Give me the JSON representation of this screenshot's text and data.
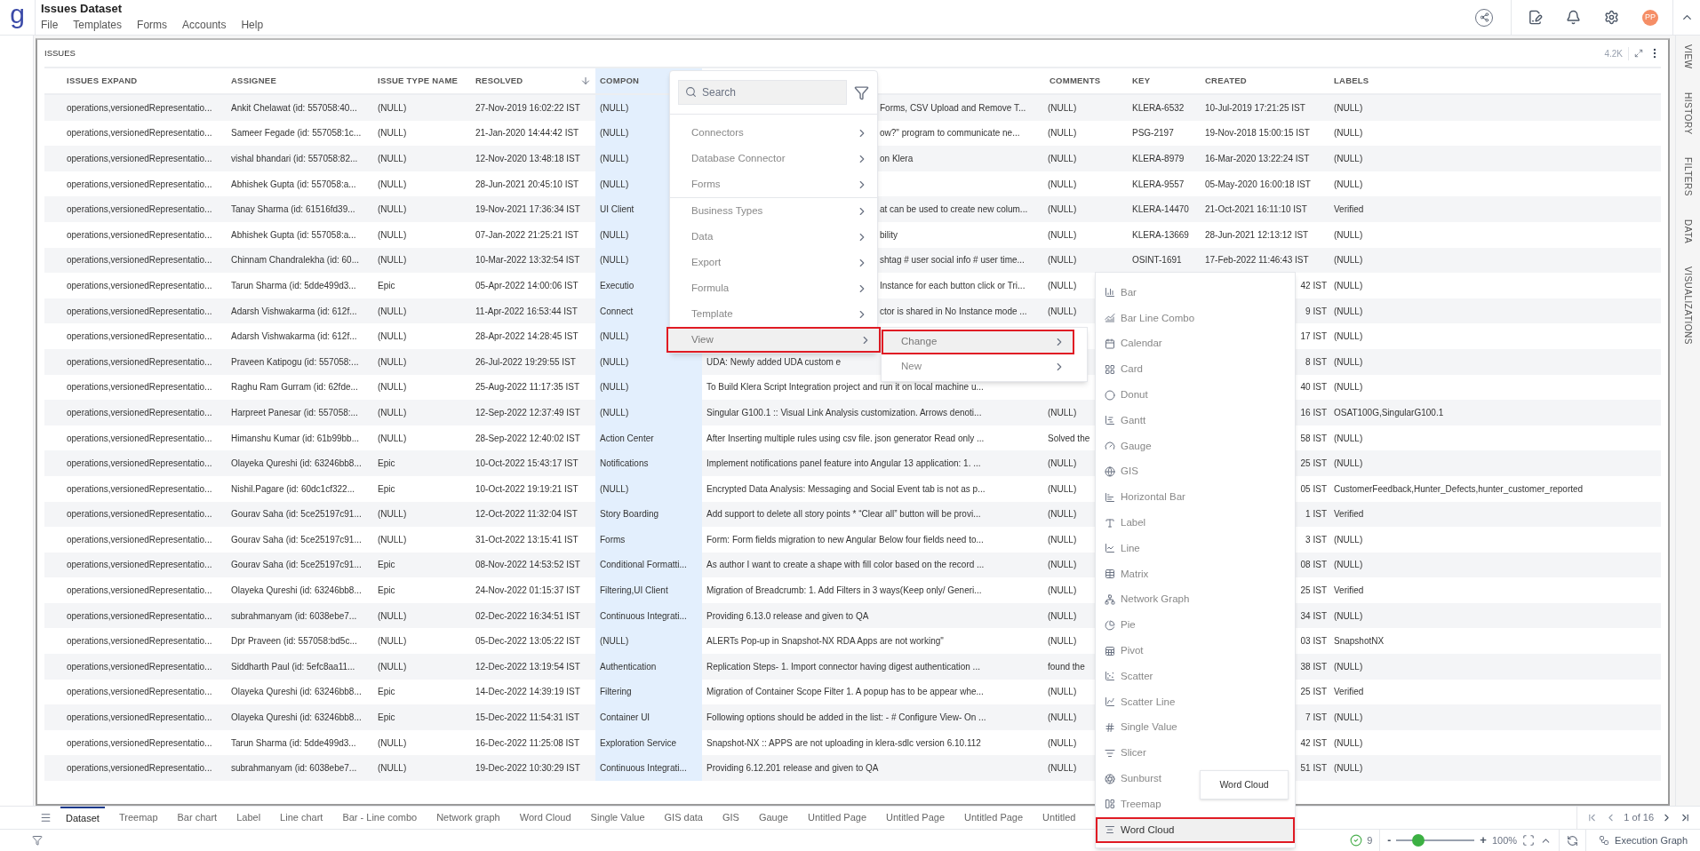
{
  "app": {
    "logo": "g",
    "title": "Issues Dataset",
    "menu": [
      "File",
      "Templates",
      "Forms",
      "Accounts",
      "Help"
    ],
    "avatar": "PP"
  },
  "side_tabs": [
    "VIEW",
    "HISTORY",
    "FILTERS",
    "DATA",
    "VISUALIZATIONS"
  ],
  "panel": {
    "title": "ISSUES",
    "count": "4.2K"
  },
  "table": {
    "columns": [
      {
        "label": "ISSUES EXPAND",
        "sorted": false,
        "highlighted": false
      },
      {
        "label": "ASSIGNEE",
        "sorted": false,
        "highlighted": false
      },
      {
        "label": "ISSUE TYPE NAME",
        "sorted": false,
        "highlighted": false
      },
      {
        "label": "RESOLVED",
        "sorted": true,
        "highlighted": false
      },
      {
        "label": "COMPON",
        "sorted": false,
        "highlighted": true
      },
      null,
      {
        "label": "COMMENTS",
        "sorted": false,
        "highlighted": false
      },
      {
        "label": "KEY",
        "sorted": false,
        "highlighted": false
      },
      {
        "label": "CREATED",
        "sorted": false,
        "highlighted": false
      },
      {
        "label": "LABELS",
        "sorted": false,
        "highlighted": false
      }
    ],
    "rows": [
      [
        "operations,versionedRepresentatio...",
        "Ankit Chelawat (id: 557058:40...",
        "(NULL)",
        "27-Nov-2019 16:02:22 IST",
        "(NULL)",
        "Forms, CSV Upload and Remove T...",
        "(NULL)",
        "KLERA-6532",
        "10-Jul-2019 17:21:25 IST",
        "(NULL)"
      ],
      [
        "operations,versionedRepresentatio...",
        "Sameer Fegade (id: 557058:1c...",
        "(NULL)",
        "21-Jan-2020 14:44:42 IST",
        "(NULL)",
        "ow?\" program to communicate ne...",
        "(NULL)",
        "PSG-2197",
        "19-Nov-2018 15:00:15 IST",
        "(NULL)"
      ],
      [
        "operations,versionedRepresentatio...",
        "vishal bhandari (id: 557058:82...",
        "(NULL)",
        "12-Nov-2020 13:48:18 IST",
        "(NULL)",
        "on Klera",
        "(NULL)",
        "KLERA-8979",
        "16-Mar-2020 13:22:24 IST",
        "(NULL)"
      ],
      [
        "operations,versionedRepresentatio...",
        "Abhishek Gupta (id: 557058:a...",
        "(NULL)",
        "28-Jun-2021 20:45:10 IST",
        "(NULL)",
        null,
        "(NULL)",
        "KLERA-9557",
        "05-May-2020 16:00:18 IST",
        "(NULL)"
      ],
      [
        "operations,versionedRepresentatio...",
        "Tanay Sharma (id: 61516fd39...",
        "(NULL)",
        "19-Nov-2021 17:36:34 IST",
        "UI Client",
        "at can be used to create new colum...",
        "(NULL)",
        "KLERA-14470",
        "21-Oct-2021 16:11:10 IST",
        "Verified"
      ],
      [
        "operations,versionedRepresentatio...",
        "Abhishek Gupta (id: 557058:a...",
        "(NULL)",
        "07-Jan-2022 21:25:21 IST",
        "(NULL)",
        "bility",
        "(NULL)",
        "KLERA-13669",
        "28-Jun-2021 12:13:12 IST",
        "(NULL)"
      ],
      [
        "operations,versionedRepresentatio...",
        "Chinnam Chandralekha (id: 60...",
        "(NULL)",
        "10-Mar-2022 13:32:54 IST",
        "(NULL)",
        "shtag # user social info # user time...",
        "(NULL)",
        "OSINT-1691",
        "17-Feb-2022 11:46:43 IST",
        "(NULL)"
      ],
      [
        "operations,versionedRepresentatio...",
        "Tarun Sharma (id: 5dde499d3...",
        "Epic",
        "05-Apr-2022 14:00:06 IST",
        "Executio",
        "Instance for each button click or Tri...",
        "(NULL)",
        null,
        "42 IST",
        "(NULL)"
      ],
      [
        "operations,versionedRepresentatio...",
        "Adarsh Vishwakarma (id: 612f...",
        "(NULL)",
        "11-Apr-2022 16:53:44 IST",
        "Connect",
        "ctor is shared in No Instance mode ...",
        "(NULL)",
        null,
        "9 IST",
        "(NULL)"
      ],
      [
        "operations,versionedRepresentatio...",
        "Adarsh Vishwakarma (id: 612f...",
        "(NULL)",
        "28-Apr-2022 14:28:45 IST",
        "(NULL)",
        null,
        null,
        null,
        "17 IST",
        "(NULL)"
      ],
      [
        "operations,versionedRepresentatio...",
        "Praveen Katipogu (id: 557058:...",
        "(NULL)",
        "26-Jul-2022 19:29:55 IST",
        "(NULL)",
        "UDA: Newly added UDA custom e",
        null,
        null,
        "8 IST",
        "(NULL)"
      ],
      [
        "operations,versionedRepresentatio...",
        "Raghu Ram Gurram (id: 62fde...",
        "(NULL)",
        "25-Aug-2022 11:17:35 IST",
        "(NULL)",
        "To Build Klera Script Integration project and run it on local machine u...",
        null,
        null,
        "40 IST",
        "(NULL)"
      ],
      [
        "operations,versionedRepresentatio...",
        "Harpreet Panesar (id: 557058:...",
        "(NULL)",
        "12-Sep-2022 12:37:49 IST",
        "(NULL)",
        "Singular G100.1 :: Visual Link Analysis customization. Arrows denoti...",
        "(NULL)",
        null,
        "16 IST",
        "OSAT100G,SingularG100.1"
      ],
      [
        "operations,versionedRepresentatio...",
        "Himanshu Kumar (id: 61b99bb...",
        "(NULL)",
        "28-Sep-2022 12:40:02 IST",
        "Action Center",
        "After Inserting multiple rules using csv file. json generator Read only ...",
        "Solved the",
        null,
        "58 IST",
        "(NULL)"
      ],
      [
        "operations,versionedRepresentatio...",
        "Olayeka Qureshi (id: 63246bb8...",
        "Epic",
        "10-Oct-2022 15:43:17 IST",
        "Notifications",
        "Implement notifications panel feature into Angular 13 application: 1. ...",
        "(NULL)",
        null,
        "25 IST",
        "(NULL)"
      ],
      [
        "operations,versionedRepresentatio...",
        "Nishil.Pagare (id: 60dc1cf322...",
        "Epic",
        "10-Oct-2022 19:19:21 IST",
        "(NULL)",
        "Encrypted Data Analysis: Messaging and Social Event tab is not as p...",
        "(NULL)",
        null,
        "05 IST",
        "CustomerFeedback,Hunter_Defects,hunter_customer_reported"
      ],
      [
        "operations,versionedRepresentatio...",
        "Gourav Saha (id: 5ce25197c91...",
        "(NULL)",
        "12-Oct-2022 11:32:04 IST",
        "Story Boarding",
        "Add support to delete all story points * “Clear all” button will be provi...",
        "(NULL)",
        null,
        "1 IST",
        "Verified"
      ],
      [
        "operations,versionedRepresentatio...",
        "Gourav Saha (id: 5ce25197c91...",
        "(NULL)",
        "31-Oct-2022 13:15:41 IST",
        "Forms",
        "Form: Form fields migration to new Angular Below four fields need to...",
        "(NULL)",
        null,
        "3 IST",
        "(NULL)"
      ],
      [
        "operations,versionedRepresentatio...",
        "Gourav Saha (id: 5ce25197c91...",
        "Epic",
        "08-Nov-2022 14:53:52 IST",
        "Conditional Formatti...",
        "As author I want to create a shape with fill color based on the record ...",
        "(NULL)",
        null,
        "08 IST",
        "(NULL)"
      ],
      [
        "operations,versionedRepresentatio...",
        "Olayeka Qureshi (id: 63246bb8...",
        "Epic",
        "24-Nov-2022 01:15:37 IST",
        "Filtering,UI Client",
        "Migration of Breadcrumb: 1. Add Filters in 3 ways(Keep only/ Generi...",
        "(NULL)",
        null,
        "25 IST",
        "Verified"
      ],
      [
        "operations,versionedRepresentatio...",
        "subrahmanyam (id: 6038ebe7...",
        "(NULL)",
        "02-Dec-2022 16:34:51 IST",
        "Continuous Integrati...",
        "Providing 6.13.0 release and given to QA",
        "(NULL)",
        null,
        "34 IST",
        "(NULL)"
      ],
      [
        "operations,versionedRepresentatio...",
        "Dpr Praveen (id: 557058:bd5c...",
        "(NULL)",
        "05-Dec-2022 13:05:22 IST",
        "(NULL)",
        "ALERTs Pop-up in Snapshot-NX RDA Apps are not working\"",
        "(NULL)",
        null,
        "03 IST",
        "SnapshotNX"
      ],
      [
        "operations,versionedRepresentatio...",
        "Siddharth Paul (id: 5efc8aa11...",
        "(NULL)",
        "12-Dec-2022 13:19:54 IST",
        "Authentication",
        "Replication Steps- 1. Import connector having digest authentication ...",
        "found the",
        null,
        "38 IST",
        "(NULL)"
      ],
      [
        "operations,versionedRepresentatio...",
        "Olayeka Qureshi (id: 63246bb8...",
        "Epic",
        "14-Dec-2022 14:39:19 IST",
        "Filtering",
        "Migration of Container Scope Filter 1. A popup has to be appear whe...",
        "(NULL)",
        null,
        "25 IST",
        "Verified"
      ],
      [
        "operations,versionedRepresentatio...",
        "Olayeka Qureshi (id: 63246bb8...",
        "Epic",
        "15-Dec-2022 11:54:31 IST",
        "Container UI",
        "Following options should be added in the list: - # Configure View- On ...",
        "(NULL)",
        null,
        "7 IST",
        "(NULL)"
      ],
      [
        "operations,versionedRepresentatio...",
        "Tarun Sharma (id: 5dde499d3...",
        "(NULL)",
        "16-Dec-2022 11:25:08 IST",
        "Exploration Service",
        "Snapshot-NX :: APPS are not uploading in klera-sdlc version 6.10.112",
        "(NULL)",
        null,
        "42 IST",
        "(NULL)"
      ],
      [
        "operations,versionedRepresentatio...",
        "subrahmanyam (id: 6038ebe7...",
        "(NULL)",
        "19-Dec-2022 10:30:29 IST",
        "Continuous Integrati...",
        "Providing 6.12.201 release and given to QA",
        "(NULL)",
        null,
        "51 IST",
        "(NULL)"
      ]
    ]
  },
  "context_menu": {
    "search": {
      "placeholder": "Search"
    },
    "groups": [
      [
        {
          "label": "Connectors",
          "selected": false
        },
        {
          "label": "Database Connector",
          "selected": false
        },
        {
          "label": "Forms",
          "selected": false
        }
      ],
      [
        {
          "label": "Business Types",
          "selected": false
        },
        {
          "label": "Data",
          "selected": false
        },
        {
          "label": "Export",
          "selected": false
        },
        {
          "label": "Formula",
          "selected": false
        },
        {
          "label": "Template",
          "selected": false
        },
        {
          "label": "View",
          "selected": true
        }
      ]
    ]
  },
  "view_submenu": [
    {
      "label": "Change",
      "selected": true
    },
    {
      "label": "New",
      "selected": false
    }
  ],
  "change_submenu": [
    {
      "label": "Bar",
      "selected": false
    },
    {
      "label": "Bar Line Combo",
      "selected": false
    },
    {
      "label": "Calendar",
      "selected": false
    },
    {
      "label": "Card",
      "selected": false
    },
    {
      "label": "Donut",
      "selected": false
    },
    {
      "label": "Gantt",
      "selected": false
    },
    {
      "label": "Gauge",
      "selected": false
    },
    {
      "label": "GIS",
      "selected": false
    },
    {
      "label": "Horizontal Bar",
      "selected": false
    },
    {
      "label": "Label",
      "selected": false
    },
    {
      "label": "Line",
      "selected": false
    },
    {
      "label": "Matrix",
      "selected": false
    },
    {
      "label": "Network Graph",
      "selected": false
    },
    {
      "label": "Pie",
      "selected": false
    },
    {
      "label": "Pivot",
      "selected": false
    },
    {
      "label": "Scatter",
      "selected": false
    },
    {
      "label": "Scatter Line",
      "selected": false
    },
    {
      "label": "Single Value",
      "selected": false
    },
    {
      "label": "Slicer",
      "selected": false
    },
    {
      "label": "Sunburst",
      "selected": false
    },
    {
      "label": "Treemap",
      "selected": false
    },
    {
      "label": "Word Cloud",
      "selected": true
    }
  ],
  "tooltip": "Word Cloud",
  "sheet_tabs": [
    {
      "label": "Dataset",
      "selected": true
    },
    {
      "label": "Treemap",
      "selected": false
    },
    {
      "label": "Bar chart",
      "selected": false
    },
    {
      "label": "Label",
      "selected": false
    },
    {
      "label": "Line chart",
      "selected": false
    },
    {
      "label": "Bar - Line combo",
      "selected": false
    },
    {
      "label": "Network graph",
      "selected": false
    },
    {
      "label": "Word Cloud",
      "selected": false
    },
    {
      "label": "Single Value",
      "selected": false
    },
    {
      "label": "GIS data",
      "selected": false
    },
    {
      "label": "GIS",
      "selected": false
    },
    {
      "label": "Gauge",
      "selected": false
    },
    {
      "label": "Untitled Page",
      "selected": false
    },
    {
      "label": "Untitled Page",
      "selected": false
    },
    {
      "label": "Untitled Page",
      "selected": false
    },
    {
      "label": "Untitled",
      "selected": false
    }
  ],
  "pager": "1 of 16",
  "status_bar": {
    "checks": "9",
    "zoom": {
      "minus": "-",
      "plus": "+",
      "level": 0.28,
      "reading": "100%"
    },
    "execution_graph": "Execution Graph"
  }
}
